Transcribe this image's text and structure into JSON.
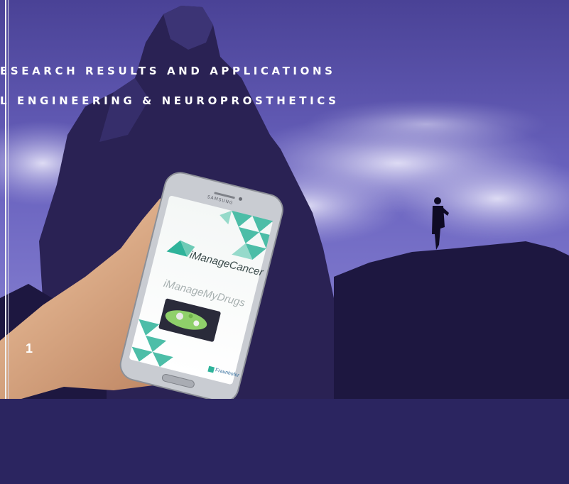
{
  "heading": {
    "line1": "ESEARCH RESULTS AND APPLICATIONS",
    "line2": "L ENGINEERING & NEUROPROSTHETICS"
  },
  "page_number": "1",
  "phone": {
    "brand": "SAMSUNG",
    "app1": "iManageCancer",
    "app2": "iManageMyDrugs",
    "logo_text": "Fraunhofer"
  },
  "colors": {
    "sky": "#5c54b0",
    "cloud": "#c9c6ec",
    "rock": "#1d1740",
    "accent": "#2fb39a"
  }
}
